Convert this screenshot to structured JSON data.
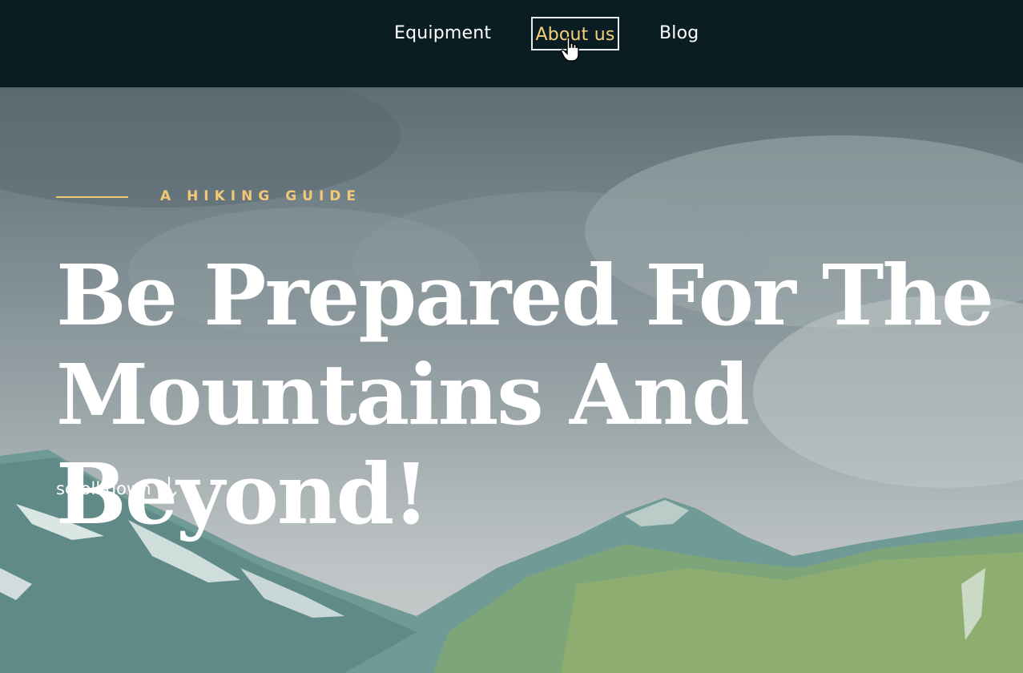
{
  "nav": {
    "items": [
      {
        "label": "Equipment"
      },
      {
        "label": "About us"
      },
      {
        "label": "Blog"
      }
    ],
    "active_color": "#f4cf7e"
  },
  "hero": {
    "tagline": "A HIKING GUIDE",
    "headline_line1": "Be Prepared For The",
    "headline_line2": "Mountains And Beyond!",
    "scroll_label": "scroll down",
    "scroll_icon": "arrow-down-icon",
    "accent_color": "#f2c877"
  },
  "colors": {
    "topbar": "#0a1d23",
    "text": "#ffffff"
  }
}
